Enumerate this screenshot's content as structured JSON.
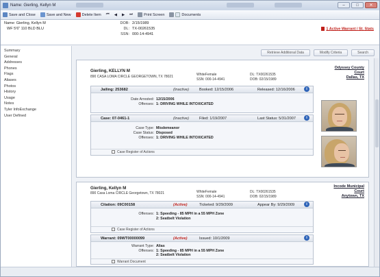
{
  "title_bar": {
    "title": "Name: Gierling, Kellyn M"
  },
  "toolbar": {
    "save_close": "Save and Close",
    "save_new": "Save and New",
    "delete_item": "Delete Item",
    "print_screen": "Print Screen",
    "documents": "Documents"
  },
  "person": {
    "name_line": "Name: Gierling, Kellyn M",
    "desc_line": "WF 5'6\" 110 BLD BLU",
    "dob_label": "DOB:",
    "dob": "2/15/1989",
    "dl_label": "DL:",
    "dl": "TX-00261535",
    "ssn_label": "SSN:",
    "ssn": "000-14-4941",
    "warrant_alert": "1 Active Warrant / St. Stats"
  },
  "sidebar": {
    "items": [
      "Summary",
      "General",
      "Addresses",
      "Phones",
      "Flags",
      "Aliases",
      "Photos",
      "History",
      "Usage",
      "Notes",
      "Tyler InfoExchange",
      "User Defined"
    ]
  },
  "main_buttons": {
    "retrieve": "Retrieve Additional Data",
    "modify": "Modify Criteria",
    "search": "Search"
  },
  "record1": {
    "name": "Gierling, KELLYN M",
    "address": "890 CASA LOMA CIRCLE GEORGETOWN, TX 78021",
    "race_sex": "WhiteFemale",
    "ssn": "SSN: 000-14-4941",
    "dl": "DL: TX00261535",
    "dob": "DOB: 02/15/1989",
    "court": [
      "Odyssey County",
      "Court",
      "Dallas, TX"
    ],
    "jailing": {
      "title": "Jailing: 253682",
      "status": "(Inactive)",
      "booked": "Booked: 12/15/2006",
      "released": "Released: 12/16/2006",
      "date_arrested_label": "Date Arrested:",
      "date_arrested": "12/15/2006",
      "offenses_label": "Offenses:",
      "offenses": "1: DRIVING WHILE INTOXICATED"
    },
    "case": {
      "title": "Case: 07-0461-1",
      "status": "(Inactive)",
      "filed": "Filed: 1/19/2007",
      "last_status": "Last Status: 5/31/2007",
      "case_type_label": "Case Type:",
      "case_type": "Misdemeanor",
      "case_status_label": "Case Status:",
      "case_status": "Disposed",
      "offenses_label": "Offenses:",
      "offenses": "1: DRIVING WHILE INTOXICATED",
      "register": "Case Register of Actions"
    }
  },
  "record2": {
    "name": "Gierling, Kellyn M",
    "address": "890 Casa Loma CIRCLE Georgetown, TX 78021",
    "race_sex": "WhiteFemale",
    "ssn": "SSN: 000-14-4941",
    "dl": "DL: TX00261535",
    "dob": "DOB: 02/15/1989",
    "court": [
      "Incode Municipal",
      "Court",
      "Anytown, TX"
    ],
    "citation": {
      "title": "Citation: 09C00158",
      "status": "(Active)",
      "ticketed": "Ticketed: 9/29/2009",
      "appear": "Appear By: 9/29/2009",
      "offenses_label": "Offenses:",
      "offense1": "1: Speeding - 85 MPH in a 55 MPH Zone",
      "offense2": "2: Seatbelt Violation",
      "register": "Case Register of Actions"
    },
    "warrant": {
      "title": "Warrant: 09WT00000099",
      "status": "(Active)",
      "issued": "Issued: 10/1/2009",
      "type_label": "Warrant Type:",
      "type": "Alias",
      "offenses_label": "Offenses:",
      "offense1": "1: Speeding - 85 MPH in a 55 MPH Zone",
      "offense2": "2: Seatbelt Violation",
      "document": "Warrant Document"
    }
  },
  "colors": {
    "active": "#c0201a",
    "info_icon": "#2f64b8",
    "accent": "#5c86c2"
  }
}
